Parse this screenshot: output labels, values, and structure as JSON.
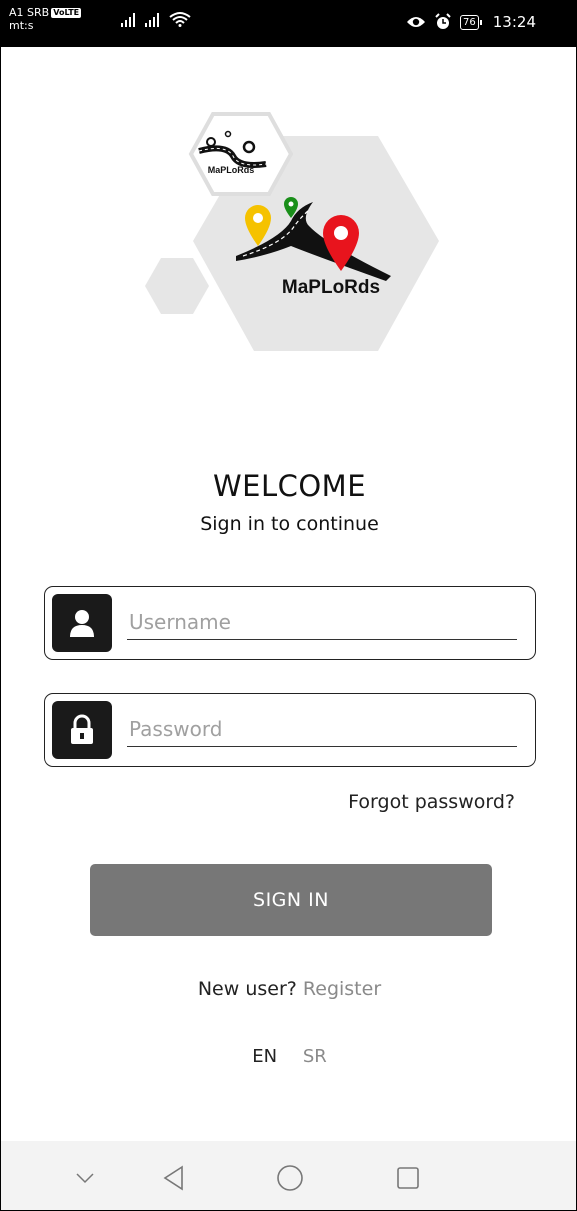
{
  "status_bar": {
    "carrier": "A1 SRB",
    "volte": "VoLTE",
    "carrier_sub": "mt:s",
    "battery": "76",
    "time": "13:24"
  },
  "logo": {
    "text_small": "MaPLoRds",
    "text_large": "MaPLoRds"
  },
  "welcome": {
    "title": "WELCOME",
    "subtitle": "Sign in to continue"
  },
  "form": {
    "username_placeholder": "Username",
    "username_value": "",
    "password_placeholder": "Password",
    "password_value": "",
    "forgot_label": "Forgot password?",
    "signin_label": "SIGN IN"
  },
  "register": {
    "prompt": "New user?",
    "link": "Register"
  },
  "languages": [
    "EN",
    "SR"
  ],
  "icons": {
    "username": "user-icon",
    "password": "lock-icon",
    "nav": [
      "chevron-down-icon",
      "back-icon",
      "home-icon",
      "recents-icon"
    ]
  },
  "colors": {
    "signin_button": "#777777",
    "pin_yellow": "#f5c200",
    "pin_red": "#e8141d",
    "pin_green": "#1a8f1a"
  }
}
